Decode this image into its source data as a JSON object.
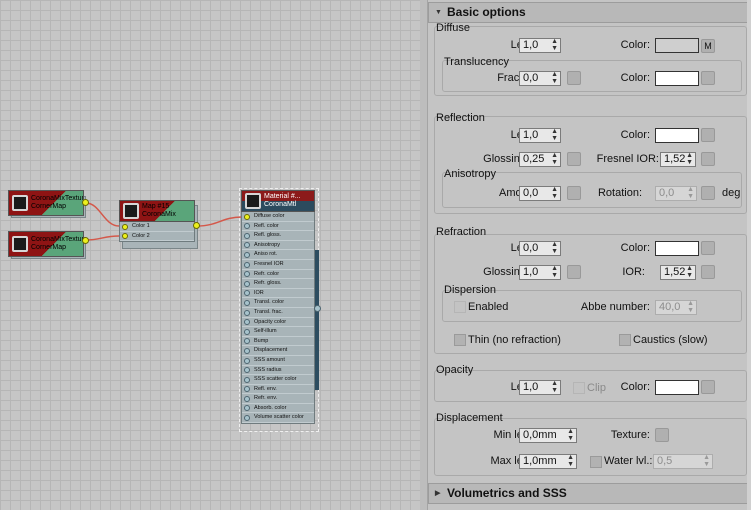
{
  "node_editor": {
    "nodes": [
      {
        "id": "texA",
        "line1": "CoronaMixTexture",
        "line2": "CornerMap"
      },
      {
        "id": "texB",
        "line1": "CoronaMixTexture",
        "line2": "CornerMap"
      },
      {
        "id": "mix",
        "line1": "Map #15",
        "line2": "CoronaMix",
        "collapse": "—",
        "inputs": [
          "Color 1",
          "Color 2"
        ]
      },
      {
        "id": "mtl",
        "line1": "Material #...",
        "line2": "CoronaMtl",
        "collapse": "—",
        "inputs": [
          "Diffuse color",
          "Refl. color",
          "Refl. gloss.",
          "Anisotropy",
          "Aniso rot.",
          "Fresnel IOR",
          "Refr. color",
          "Refr. gloss.",
          "IOR",
          "Transl. color",
          "Transl. frac.",
          "Opacity color",
          "Self-illum",
          "Bump",
          "Displacement",
          "SSS amount",
          "SSS radius",
          "SSS scatter color",
          "Refl. env.",
          "Refr. env.",
          "Absorb. color",
          "Volume scatter color"
        ]
      }
    ]
  },
  "panel": {
    "rollout_basic": {
      "arrow": "▼",
      "title": "Basic options"
    },
    "diffuse": {
      "title": "Diffuse",
      "level_label": "Level:",
      "level_value": "1,0",
      "color_label": "Color:",
      "color_value": "#cfcfcf",
      "map_button": "M",
      "translucency_title": "Translucency",
      "fraction_label": "Fraction:",
      "fraction_value": "0,0",
      "t_color_label": "Color:",
      "t_color_value": "#ffffff"
    },
    "reflection": {
      "title": "Reflection",
      "level_label": "Level:",
      "level_value": "1,0",
      "color_label": "Color:",
      "color_value": "#ffffff",
      "gloss_label": "Glossiness:",
      "gloss_value": "0,25",
      "fresnel_label": "Fresnel IOR:",
      "fresnel_value": "1,52",
      "anisotropy_title": "Anisotropy",
      "amount_label": "Amount:",
      "amount_value": "0,0",
      "rotation_label": "Rotation:",
      "rotation_value": "0,0",
      "rotation_unit": "deg"
    },
    "refraction": {
      "title": "Refraction",
      "level_label": "Level:",
      "level_value": "0,0",
      "color_label": "Color:",
      "color_value": "#ffffff",
      "gloss_label": "Glossiness:",
      "gloss_value": "1,0",
      "ior_label": "IOR:",
      "ior_value": "1,52",
      "dispersion_title": "Dispersion",
      "enabled_label": "Enabled",
      "abbe_label": "Abbe number:",
      "abbe_value": "40,0",
      "thin_label": "Thin (no refraction)",
      "caustics_label": "Caustics (slow)"
    },
    "opacity": {
      "title": "Opacity",
      "level_label": "Level:",
      "level_value": "1,0",
      "clip_label": "Clip",
      "color_label": "Color:",
      "color_value": "#ffffff"
    },
    "displacement": {
      "title": "Displacement",
      "min_label": "Min level:",
      "min_value": "0,0mm",
      "texture_label": "Texture:",
      "max_label": "Max level:",
      "max_value": "1,0mm",
      "water_label": "Water lvl.:",
      "water_value": "0,5"
    },
    "rollout_vol": {
      "arrow": "▶",
      "title": "Volumetrics and SSS"
    }
  },
  "colors": {
    "texture_header": "#8e1414",
    "texture_body": "#5aa57a",
    "material_band": "#2c4b5e",
    "wire": "#d4584a",
    "port_active": "#ecf01e"
  }
}
